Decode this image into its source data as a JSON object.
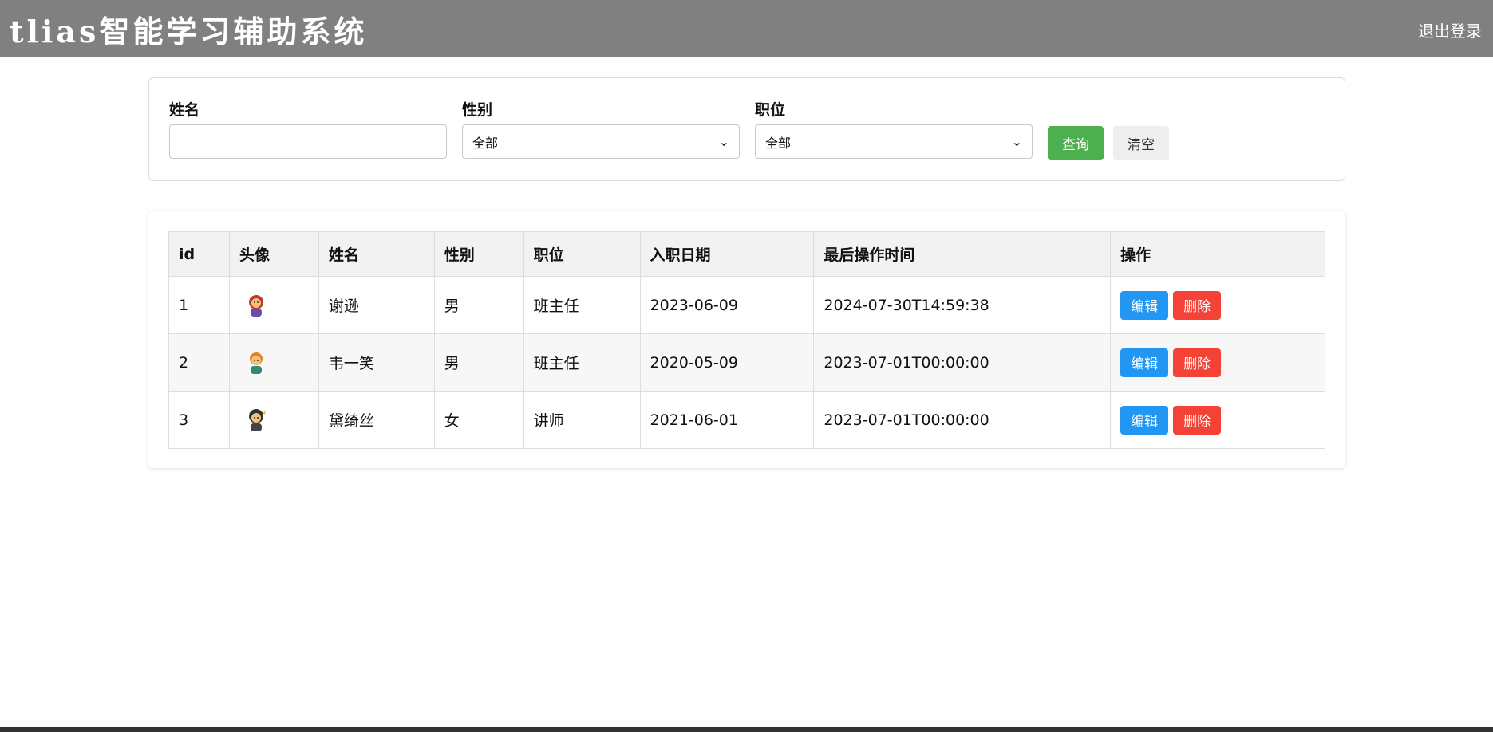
{
  "header": {
    "app_title": "tlias智能学习辅助系统",
    "logout_label": "退出登录"
  },
  "filters": {
    "name": {
      "label": "姓名",
      "value": ""
    },
    "gender": {
      "label": "性别",
      "selected": "全部"
    },
    "position": {
      "label": "职位",
      "selected": "全部"
    },
    "query_label": "查询",
    "clear_label": "清空"
  },
  "table": {
    "columns": [
      "id",
      "头像",
      "姓名",
      "性别",
      "职位",
      "入职日期",
      "最后操作时间",
      "操作"
    ],
    "rows": [
      {
        "id": "1",
        "name": "谢逊",
        "gender": "男",
        "position": "班主任",
        "entry_date": "2023-06-09",
        "update_time": "2024-07-30T14:59:38",
        "edit": "编辑",
        "delete": "删除"
      },
      {
        "id": "2",
        "name": "韦一笑",
        "gender": "男",
        "position": "班主任",
        "entry_date": "2020-05-09",
        "update_time": "2023-07-01T00:00:00",
        "edit": "编辑",
        "delete": "删除"
      },
      {
        "id": "3",
        "name": "黛绮丝",
        "gender": "女",
        "position": "讲师",
        "entry_date": "2021-06-01",
        "update_time": "2023-07-01T00:00:00",
        "edit": "编辑",
        "delete": "删除"
      }
    ]
  },
  "colors": {
    "topbar": "#808080",
    "query_button": "#4caf50",
    "edit_button": "#2196f3",
    "delete_button": "#f44336"
  },
  "icons": [
    "avatar-image",
    "chevron-down-icon"
  ]
}
